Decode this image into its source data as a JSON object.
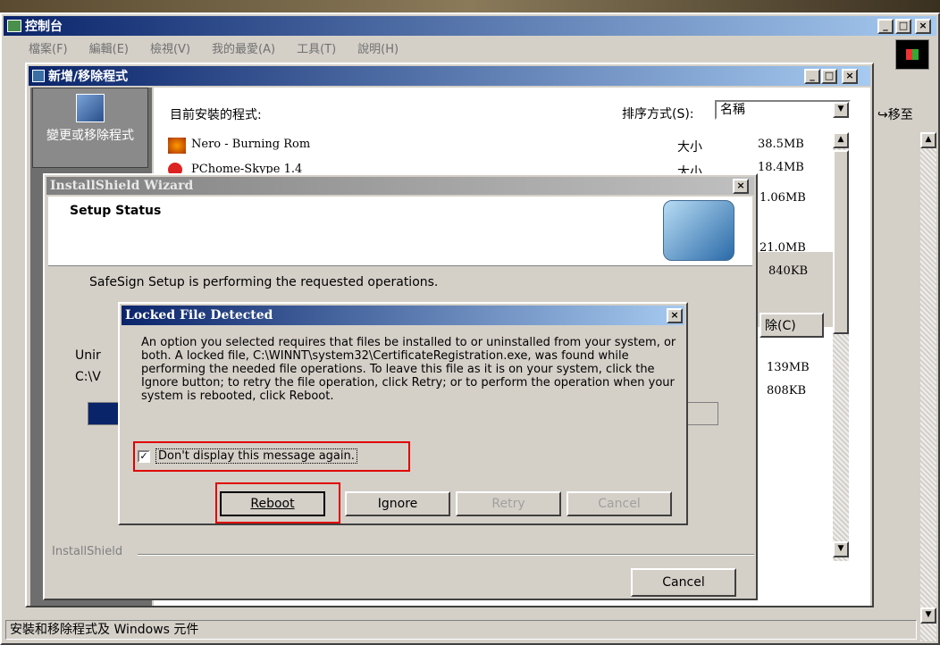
{
  "control_panel": {
    "title": "控制台",
    "menu": [
      "檔案(F)",
      "編輯(E)",
      "檢視(V)",
      "我的最愛(A)",
      "工具(T)",
      "說明(H)"
    ],
    "goto": "移至",
    "status_bar": "安裝和移除程式及 Windows 元件"
  },
  "add_remove": {
    "title": "新增/移除程式",
    "sidebar_label": "變更或移除程式",
    "installed_label": "目前安裝的程式:",
    "sort_label": "排序方式(S):",
    "sort_value": "名稱",
    "programs": [
      {
        "name": "Nero - Burning Rom",
        "size_label": "大小",
        "size": "38.5MB"
      },
      {
        "name": "PChome-Skype 1.4",
        "size_label": "大小",
        "size": "18.4MB"
      }
    ],
    "other_sizes": [
      "1.06MB",
      "21.0MB",
      "840KB",
      "139MB",
      "808KB"
    ],
    "remove_button": "除(C)"
  },
  "wizard": {
    "title": "InstallShield Wizard",
    "heading": "Setup Status",
    "status_text": "SafeSign Setup is performing the requested operations.",
    "partial_label1": "Unir",
    "partial_label2": "C:\\V",
    "footer": "InstallShield",
    "cancel_button": "Cancel"
  },
  "dialog": {
    "title": "Locked File Detected",
    "message": "An option you selected requires that files be installed to or uninstalled from your system, or both. A locked file, C:\\WINNT\\system32\\CertificateRegistration.exe, was found while performing the needed file operations. To leave this file as it is on your system, click the Ignore button; to retry the file operation, click Retry; or to perform the operation when your system is rebooted, click Reboot.",
    "checkbox_label": "Don't display this message again.",
    "checkbox_checked": true,
    "buttons": {
      "reboot": "Reboot",
      "ignore": "Ignore",
      "retry": "Retry",
      "cancel": "Cancel"
    }
  }
}
